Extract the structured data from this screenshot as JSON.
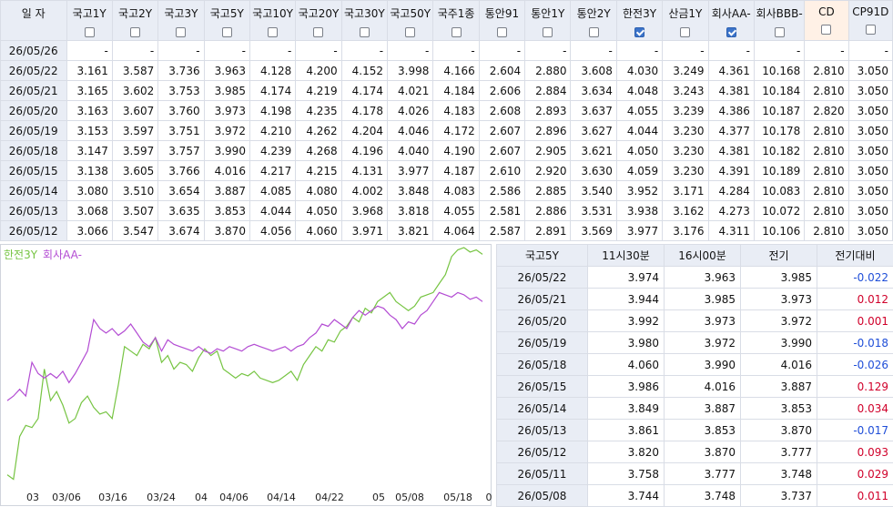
{
  "rate_table": {
    "date_header": "일  자",
    "columns": [
      {
        "label": "국고1Y",
        "checked": false
      },
      {
        "label": "국고2Y",
        "checked": false
      },
      {
        "label": "국고3Y",
        "checked": false
      },
      {
        "label": "국고5Y",
        "checked": false
      },
      {
        "label": "국고10Y",
        "checked": false
      },
      {
        "label": "국고20Y",
        "checked": false
      },
      {
        "label": "국고30Y",
        "checked": false
      },
      {
        "label": "국고50Y",
        "checked": false
      },
      {
        "label": "국주1종",
        "checked": false
      },
      {
        "label": "통안91",
        "checked": false
      },
      {
        "label": "통안1Y",
        "checked": false
      },
      {
        "label": "통안2Y",
        "checked": false
      },
      {
        "label": "한전3Y",
        "checked": true
      },
      {
        "label": "산금1Y",
        "checked": false
      },
      {
        "label": "회사AA-",
        "checked": true
      },
      {
        "label": "회사BBB-",
        "checked": false
      },
      {
        "label": "CD",
        "checked": false
      },
      {
        "label": "CP91D",
        "checked": false
      }
    ],
    "rows": [
      {
        "date": "26/05/26",
        "values": [
          "-",
          "-",
          "-",
          "-",
          "-",
          "-",
          "-",
          "-",
          "-",
          "-",
          "-",
          "-",
          "-",
          "-",
          "-",
          "-",
          "-",
          "-"
        ]
      },
      {
        "date": "26/05/22",
        "values": [
          "3.161",
          "3.587",
          "3.736",
          "3.963",
          "4.128",
          "4.200",
          "4.152",
          "3.998",
          "4.166",
          "2.604",
          "2.880",
          "3.608",
          "4.030",
          "3.249",
          "4.361",
          "10.168",
          "2.810",
          "3.050"
        ]
      },
      {
        "date": "26/05/21",
        "values": [
          "3.165",
          "3.602",
          "3.753",
          "3.985",
          "4.174",
          "4.219",
          "4.174",
          "4.021",
          "4.184",
          "2.606",
          "2.884",
          "3.634",
          "4.048",
          "3.243",
          "4.381",
          "10.184",
          "2.810",
          "3.050"
        ]
      },
      {
        "date": "26/05/20",
        "values": [
          "3.163",
          "3.607",
          "3.760",
          "3.973",
          "4.198",
          "4.235",
          "4.178",
          "4.026",
          "4.183",
          "2.608",
          "2.893",
          "3.637",
          "4.055",
          "3.239",
          "4.386",
          "10.187",
          "2.820",
          "3.050"
        ]
      },
      {
        "date": "26/05/19",
        "values": [
          "3.153",
          "3.597",
          "3.751",
          "3.972",
          "4.210",
          "4.262",
          "4.204",
          "4.046",
          "4.172",
          "2.607",
          "2.896",
          "3.627",
          "4.044",
          "3.230",
          "4.377",
          "10.178",
          "2.810",
          "3.050"
        ]
      },
      {
        "date": "26/05/18",
        "values": [
          "3.147",
          "3.597",
          "3.757",
          "3.990",
          "4.239",
          "4.268",
          "4.196",
          "4.040",
          "4.190",
          "2.607",
          "2.905",
          "3.621",
          "4.050",
          "3.230",
          "4.381",
          "10.182",
          "2.810",
          "3.050"
        ]
      },
      {
        "date": "26/05/15",
        "values": [
          "3.138",
          "3.605",
          "3.766",
          "4.016",
          "4.217",
          "4.215",
          "4.131",
          "3.977",
          "4.187",
          "2.610",
          "2.920",
          "3.630",
          "4.059",
          "3.230",
          "4.391",
          "10.189",
          "2.810",
          "3.050"
        ]
      },
      {
        "date": "26/05/14",
        "values": [
          "3.080",
          "3.510",
          "3.654",
          "3.887",
          "4.085",
          "4.080",
          "4.002",
          "3.848",
          "4.083",
          "2.586",
          "2.885",
          "3.540",
          "3.952",
          "3.171",
          "4.284",
          "10.083",
          "2.810",
          "3.050"
        ]
      },
      {
        "date": "26/05/13",
        "values": [
          "3.068",
          "3.507",
          "3.635",
          "3.853",
          "4.044",
          "4.050",
          "3.968",
          "3.818",
          "4.055",
          "2.581",
          "2.886",
          "3.531",
          "3.938",
          "3.162",
          "4.273",
          "10.072",
          "2.810",
          "3.050"
        ]
      },
      {
        "date": "26/05/12",
        "values": [
          "3.066",
          "3.547",
          "3.674",
          "3.870",
          "4.056",
          "4.060",
          "3.971",
          "3.821",
          "4.064",
          "2.587",
          "2.891",
          "3.569",
          "3.977",
          "3.176",
          "4.311",
          "10.106",
          "2.810",
          "3.050"
        ]
      }
    ]
  },
  "detail_table": {
    "headers": [
      "국고5Y",
      "11시30분",
      "16시00분",
      "전기",
      "전기대비"
    ],
    "rows": [
      {
        "date": "26/05/22",
        "v1130": "3.974",
        "v1600": "3.963",
        "prev": "3.985",
        "diff": "-0.022",
        "sign": "neg"
      },
      {
        "date": "26/05/21",
        "v1130": "3.944",
        "v1600": "3.985",
        "prev": "3.973",
        "diff": "0.012",
        "sign": "pos"
      },
      {
        "date": "26/05/20",
        "v1130": "3.992",
        "v1600": "3.973",
        "prev": "3.972",
        "diff": "0.001",
        "sign": "pos"
      },
      {
        "date": "26/05/19",
        "v1130": "3.980",
        "v1600": "3.972",
        "prev": "3.990",
        "diff": "-0.018",
        "sign": "neg"
      },
      {
        "date": "26/05/18",
        "v1130": "4.060",
        "v1600": "3.990",
        "prev": "4.016",
        "diff": "-0.026",
        "sign": "neg"
      },
      {
        "date": "26/05/15",
        "v1130": "3.986",
        "v1600": "4.016",
        "prev": "3.887",
        "diff": "0.129",
        "sign": "pos"
      },
      {
        "date": "26/05/14",
        "v1130": "3.849",
        "v1600": "3.887",
        "prev": "3.853",
        "diff": "0.034",
        "sign": "pos"
      },
      {
        "date": "26/05/13",
        "v1130": "3.861",
        "v1600": "3.853",
        "prev": "3.870",
        "diff": "-0.017",
        "sign": "neg"
      },
      {
        "date": "26/05/12",
        "v1130": "3.820",
        "v1600": "3.870",
        "prev": "3.777",
        "diff": "0.093",
        "sign": "pos"
      },
      {
        "date": "26/05/11",
        "v1130": "3.758",
        "v1600": "3.777",
        "prev": "3.748",
        "diff": "0.029",
        "sign": "pos"
      },
      {
        "date": "26/05/08",
        "v1130": "3.744",
        "v1600": "3.748",
        "prev": "3.737",
        "diff": "0.011",
        "sign": "pos"
      }
    ]
  },
  "chart_data": {
    "type": "line",
    "series": [
      {
        "name": "한전3Y",
        "color": "#76c442",
        "values": [
          3.05,
          3.03,
          3.22,
          3.27,
          3.26,
          3.3,
          3.52,
          3.38,
          3.42,
          3.36,
          3.28,
          3.3,
          3.37,
          3.4,
          3.35,
          3.32,
          3.33,
          3.3,
          3.45,
          3.62,
          3.6,
          3.58,
          3.63,
          3.61,
          3.66,
          3.55,
          3.58,
          3.52,
          3.55,
          3.54,
          3.51,
          3.57,
          3.61,
          3.58,
          3.6,
          3.52,
          3.5,
          3.48,
          3.5,
          3.49,
          3.51,
          3.48,
          3.47,
          3.46,
          3.47,
          3.49,
          3.51,
          3.47,
          3.54,
          3.58,
          3.62,
          3.6,
          3.65,
          3.64,
          3.69,
          3.71,
          3.75,
          3.73,
          3.79,
          3.77,
          3.82,
          3.84,
          3.86,
          3.82,
          3.8,
          3.78,
          3.8,
          3.84,
          3.85,
          3.86,
          3.9,
          3.94,
          4.02,
          4.05,
          4.06,
          4.04,
          4.05,
          4.03
        ]
      },
      {
        "name": "회사AA-",
        "color": "#b34cd3",
        "values": [
          3.38,
          3.4,
          3.43,
          3.4,
          3.55,
          3.5,
          3.48,
          3.5,
          3.48,
          3.51,
          3.46,
          3.5,
          3.55,
          3.6,
          3.74,
          3.7,
          3.68,
          3.7,
          3.67,
          3.69,
          3.72,
          3.68,
          3.64,
          3.62,
          3.66,
          3.6,
          3.65,
          3.63,
          3.62,
          3.61,
          3.6,
          3.62,
          3.6,
          3.59,
          3.61,
          3.6,
          3.62,
          3.61,
          3.6,
          3.62,
          3.63,
          3.62,
          3.61,
          3.6,
          3.61,
          3.62,
          3.6,
          3.62,
          3.63,
          3.66,
          3.68,
          3.72,
          3.71,
          3.74,
          3.72,
          3.7,
          3.75,
          3.78,
          3.76,
          3.78,
          3.8,
          3.79,
          3.76,
          3.74,
          3.7,
          3.73,
          3.72,
          3.76,
          3.78,
          3.82,
          3.86,
          3.85,
          3.84,
          3.86,
          3.85,
          3.83,
          3.84,
          3.82
        ]
      }
    ],
    "x_ticks": [
      "03",
      "03/06",
      "03/16",
      "03/24",
      "04",
      "04/06",
      "04/14",
      "04/22",
      "05",
      "05/08",
      "05/18",
      "0"
    ],
    "ylim": [
      3.0,
      4.06
    ]
  }
}
